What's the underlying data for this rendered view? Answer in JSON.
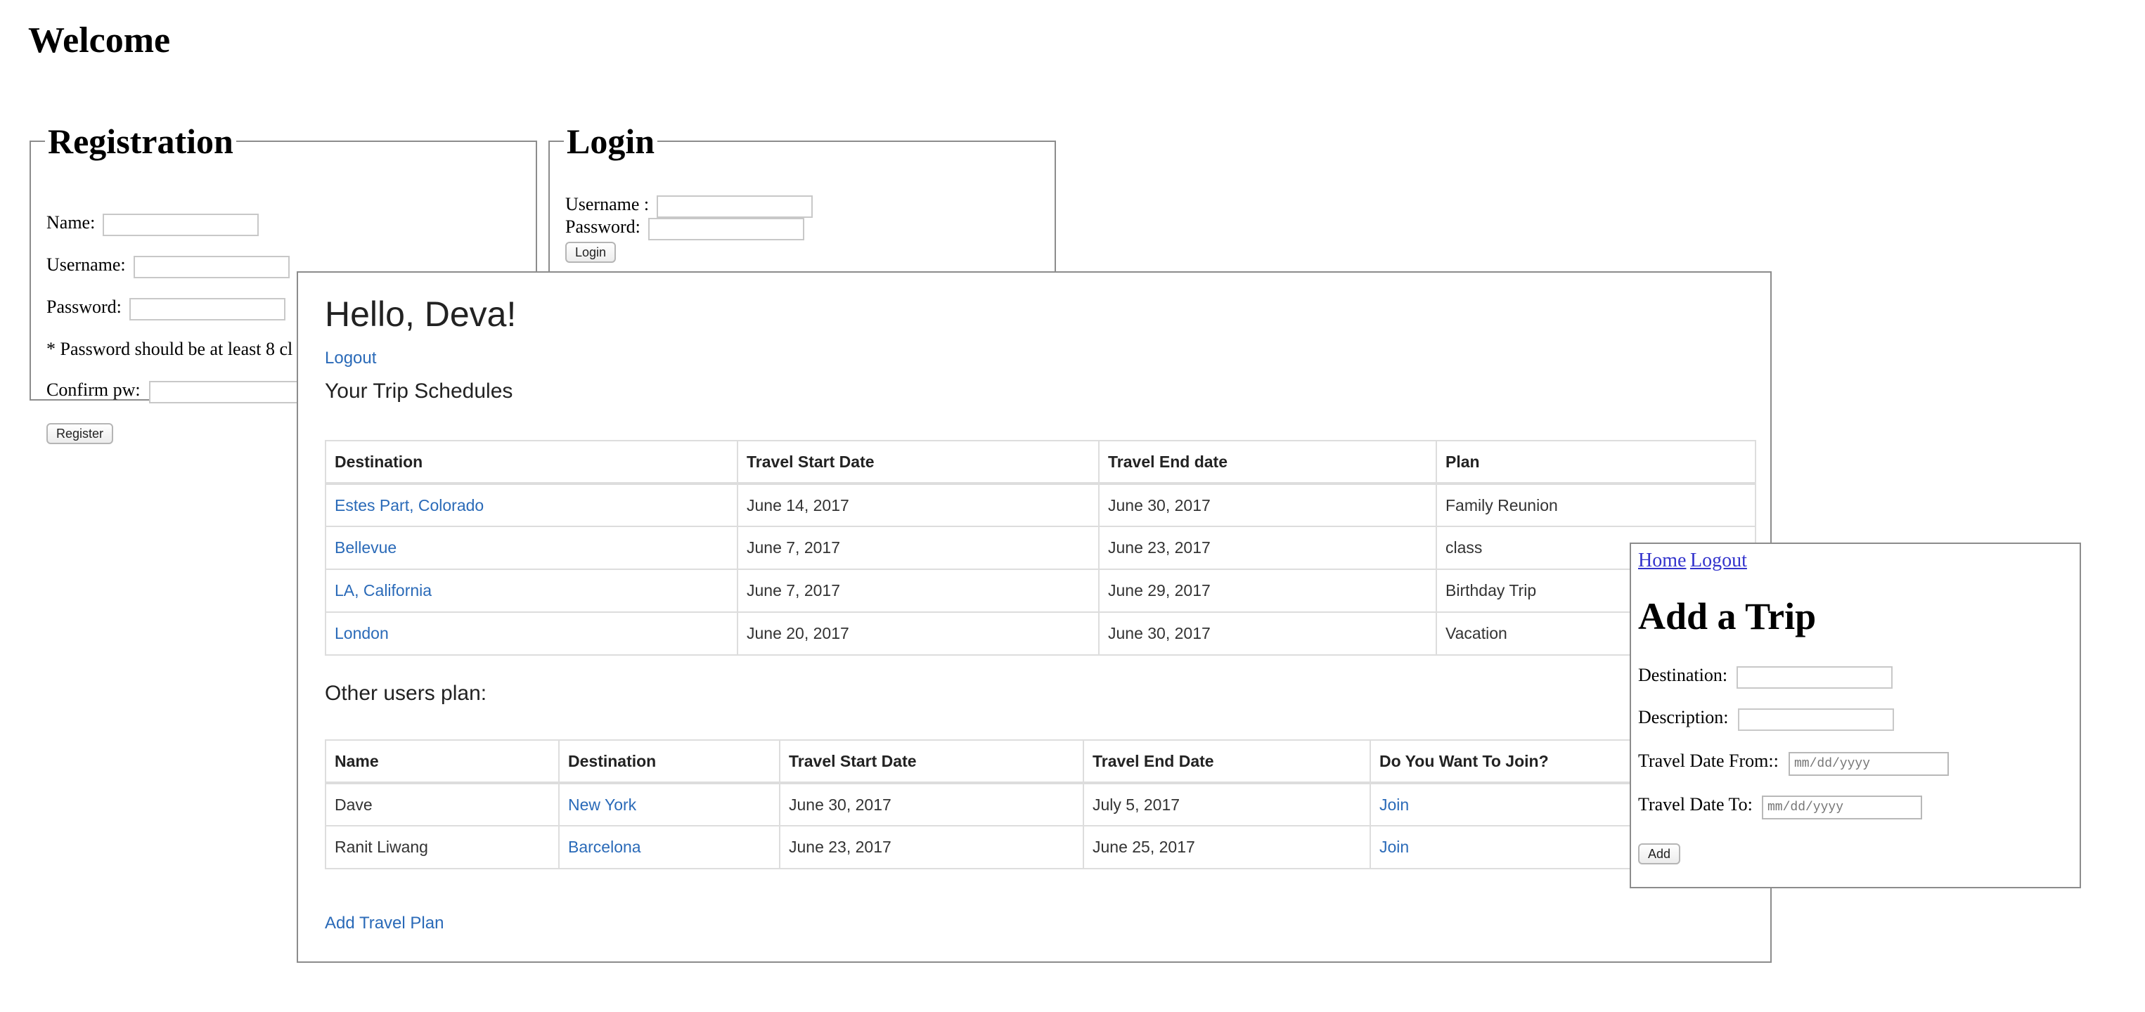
{
  "welcome": {
    "title": "Welcome",
    "registration": {
      "legend": "Registration",
      "name_label": "Name:",
      "username_label": "Username:",
      "password_label": "Password:",
      "password_note": "* Password should be at least 8 cl",
      "confirm_label": "Confirm pw:",
      "register_button": "Register"
    },
    "login": {
      "legend": "Login",
      "username_label": "Username :",
      "password_label": "Password:",
      "login_button": "Login"
    }
  },
  "dashboard": {
    "greeting": "Hello, Deva!",
    "logout": "Logout",
    "trips_heading": "Your Trip Schedules",
    "trips_table": {
      "headers": [
        "Destination",
        "Travel Start Date",
        "Travel End date",
        "Plan"
      ],
      "rows": [
        {
          "destination": "Estes Part, Colorado",
          "start": "June 14, 2017",
          "end": "June 30, 2017",
          "plan": "Family Reunion"
        },
        {
          "destination": "Bellevue",
          "start": "June 7, 2017",
          "end": "June 23, 2017",
          "plan": "class"
        },
        {
          "destination": "LA, California",
          "start": "June 7, 2017",
          "end": "June 29, 2017",
          "plan": "Birthday Trip"
        },
        {
          "destination": "London",
          "start": "June 20, 2017",
          "end": "June 30, 2017",
          "plan": "Vacation"
        }
      ]
    },
    "others_heading": "Other users plan:",
    "others_table": {
      "headers": [
        "Name",
        "Destination",
        "Travel Start Date",
        "Travel End Date",
        "Do You Want To Join?"
      ],
      "rows": [
        {
          "name": "Dave",
          "destination": "New York",
          "start": "June 30, 2017",
          "end": "July 5, 2017",
          "join": "Join"
        },
        {
          "name": "Ranit Liwang",
          "destination": "Barcelona",
          "start": "June 23, 2017",
          "end": "June 25, 2017",
          "join": "Join"
        }
      ]
    },
    "add_plan_link": "Add Travel Plan"
  },
  "add_trip": {
    "home_link": "Home",
    "logout_link": "Logout",
    "title": "Add a Trip",
    "destination_label": "Destination:",
    "description_label": "Description:",
    "date_from_label": "Travel Date From::",
    "date_to_label": "Travel Date To:",
    "date_placeholder": "mm/dd/yyyy",
    "add_button": "Add"
  }
}
